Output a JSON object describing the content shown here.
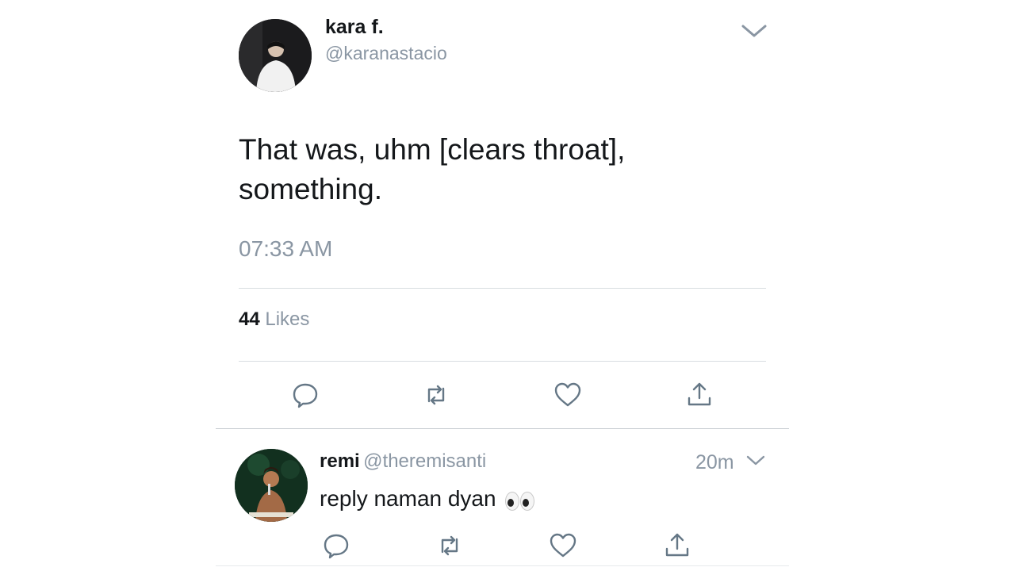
{
  "main_tweet": {
    "display_name": "kara f.",
    "handle": "@karanastacio",
    "text_line1": "That was, uhm [clears throat],",
    "text_line2": "something.",
    "timestamp": "07:33 AM",
    "likes_count": "44",
    "likes_label": "Likes",
    "actions": [
      "reply-icon",
      "retweet-icon",
      "like-icon",
      "share-icon"
    ]
  },
  "reply_tweet": {
    "display_name": "remi",
    "handle": "@theremisanti",
    "time": "20m",
    "text": "reply naman dyan",
    "emoji": "eyes-emoji",
    "actions": [
      "reply-icon",
      "retweet-icon",
      "like-icon",
      "share-icon"
    ]
  },
  "colors": {
    "text_primary": "#14171a",
    "text_secondary": "#8a96a3",
    "divider": "#d8dde1",
    "icon": "#657786"
  }
}
